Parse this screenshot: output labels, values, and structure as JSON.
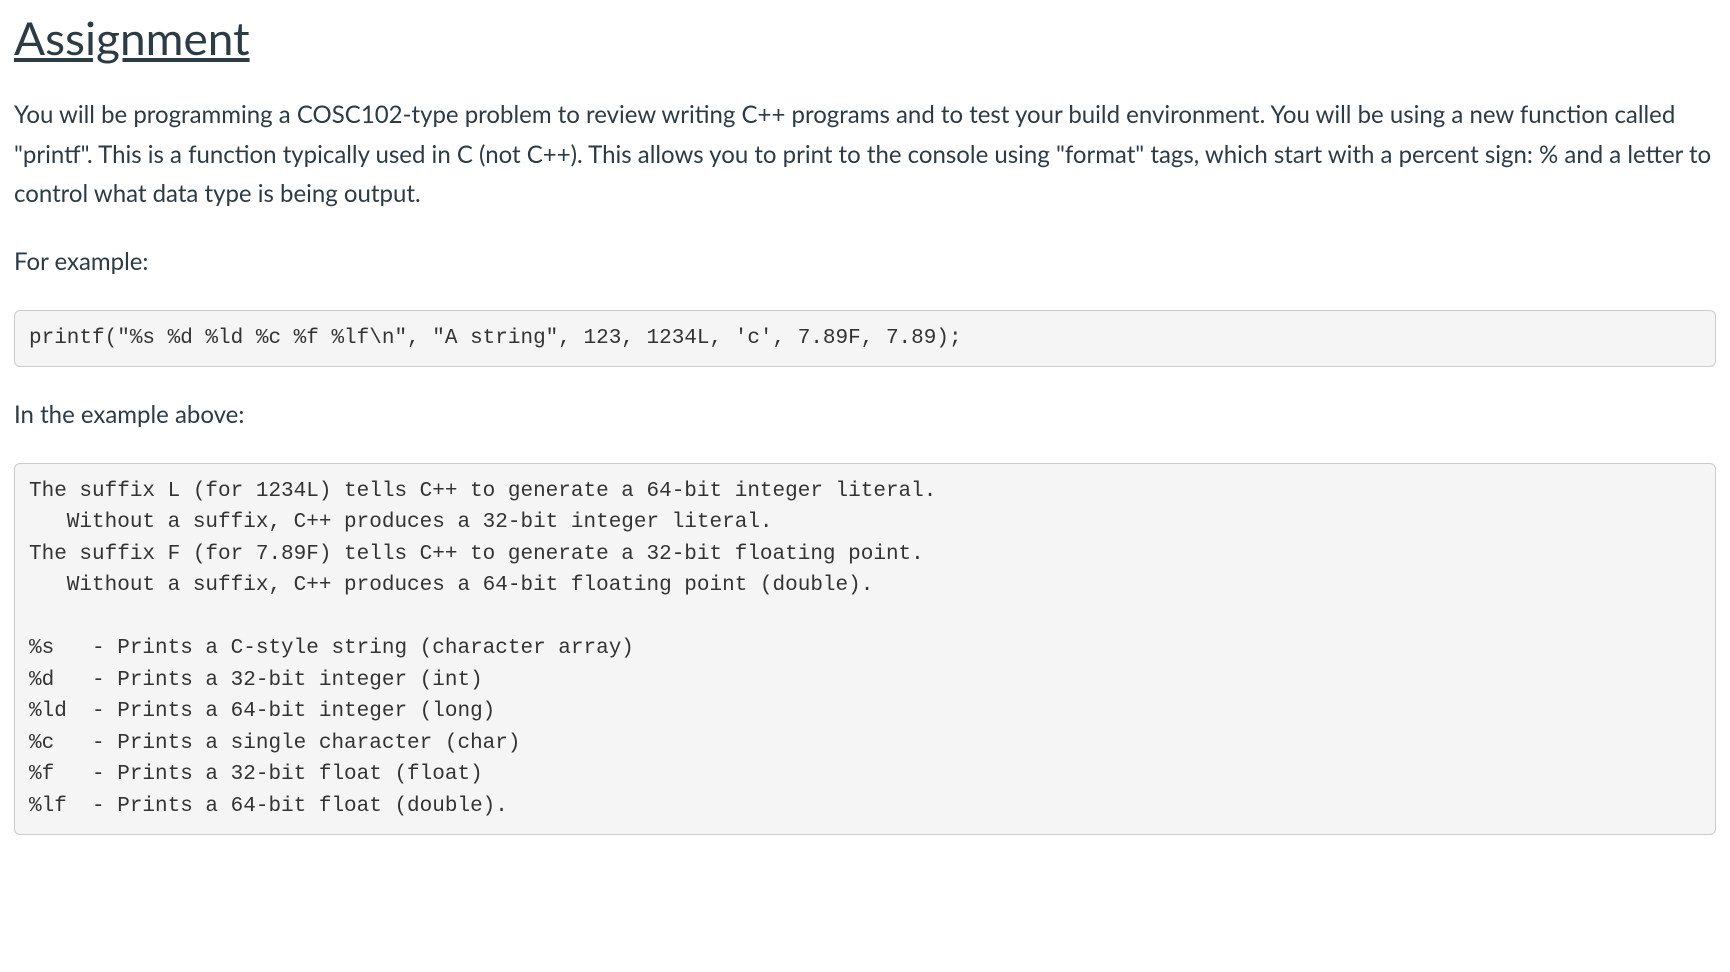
{
  "heading": "Assignment",
  "intro_paragraph": "You will be programming a COSC102-type problem to review writing C++ programs and to test your build environment. You will be using a new function called \"printf\". This is a function typically used in C (not C++). This allows you to print to the console using \"format\" tags, which start with a percent sign: % and a letter to control what data type is being output.",
  "for_example_label": "For example:",
  "code_example": "printf(\"%s %d %ld %c %f %lf\\n\", \"A string\", 123, 1234L, 'c', 7.89F, 7.89);",
  "in_example_above_label": "In the example above:",
  "explanation_block": "The suffix L (for 1234L) tells C++ to generate a 64-bit integer literal.\n   Without a suffix, C++ produces a 32-bit integer literal.\nThe suffix F (for 7.89F) tells C++ to generate a 32-bit floating point.\n   Without a suffix, C++ produces a 64-bit floating point (double).\n\n%s   - Prints a C-style string (character array)\n%d   - Prints a 32-bit integer (int)\n%ld  - Prints a 64-bit integer (long)\n%c   - Prints a single character (char)\n%f   - Prints a 32-bit float (float)\n%lf  - Prints a 64-bit float (double)."
}
